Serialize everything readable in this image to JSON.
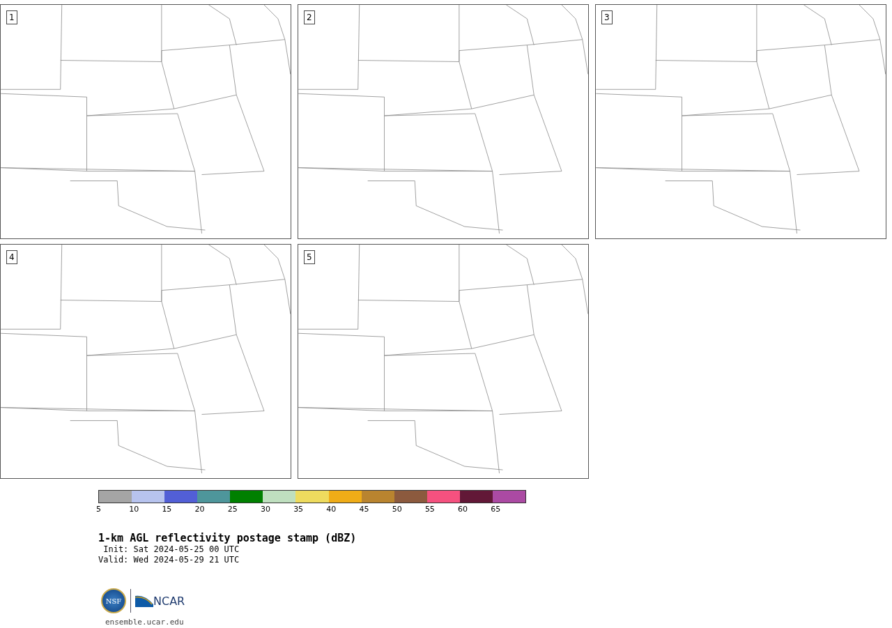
{
  "panels": [
    {
      "label": "1"
    },
    {
      "label": "2"
    },
    {
      "label": "3"
    },
    {
      "label": "4"
    },
    {
      "label": "5"
    }
  ],
  "colorbar": {
    "bins": [
      {
        "color": "#a5a5a5"
      },
      {
        "color": "#b7c3ee"
      },
      {
        "color": "#525fd6"
      },
      {
        "color": "#4e969b"
      },
      {
        "color": "#008000"
      },
      {
        "color": "#bfdfbf"
      },
      {
        "color": "#eedb5e"
      },
      {
        "color": "#efac17"
      },
      {
        "color": "#b9842f"
      },
      {
        "color": "#8c5a3e"
      },
      {
        "color": "#f5517f"
      },
      {
        "color": "#621837"
      },
      {
        "color": "#ab4aa3"
      }
    ],
    "ticks": [
      "5",
      "10",
      "15",
      "20",
      "25",
      "30",
      "35",
      "40",
      "45",
      "50",
      "55",
      "60",
      "65"
    ]
  },
  "title": "1-km AGL reflectivity postage stamp (dBZ)",
  "init": " Init: Sat 2024-05-25 00 UTC",
  "valid": "Valid: Wed 2024-05-29 21 UTC",
  "logo": {
    "nsf": "NSF",
    "ncar": "NCAR"
  },
  "site": "ensemble.ucar.edu"
}
